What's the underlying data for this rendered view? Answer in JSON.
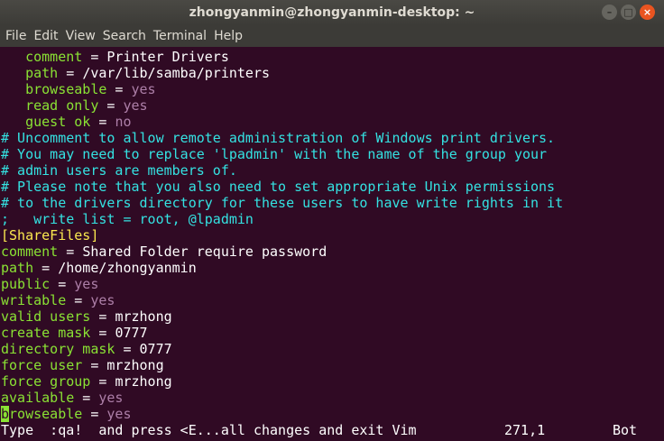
{
  "window": {
    "title": "zhongyanmin@zhongyanmin-desktop: ~",
    "minimize_glyph": "–",
    "maximize_glyph": "□",
    "close_glyph": "×"
  },
  "menu": [
    "File",
    "Edit",
    "View",
    "Search",
    "Terminal",
    "Help"
  ],
  "lines": {
    "l0": {
      "indent": "   ",
      "key": "comment",
      "eq": " = ",
      "val": "Printer Drivers"
    },
    "l1": {
      "indent": "   ",
      "key": "path",
      "eq": " = ",
      "val": "/var/lib/samba/printers"
    },
    "l2": {
      "indent": "   ",
      "key": "browseable",
      "eq": " = ",
      "val": "yes"
    },
    "l3": {
      "indent": "   ",
      "key": "read only",
      "eq": " = ",
      "val": "yes"
    },
    "l4": {
      "indent": "   ",
      "key": "guest ok",
      "eq": " = ",
      "val": "no"
    },
    "c0": "# Uncomment to allow remote administration of Windows print drivers.",
    "c1": "# You may need to replace 'lpadmin' with the name of the group your",
    "c2": "# admin users are members of.",
    "c3": "# Please note that you also need to set appropriate Unix permissions",
    "c4": "# to the drivers directory for these users to have write rights in it",
    "c5": ";   write list = root, @lpadmin",
    "section": "[ShareFiles]",
    "s0": {
      "key": "comment",
      "eq": " = ",
      "val": "Shared Folder require password"
    },
    "s1": {
      "key": "path",
      "eq": " = ",
      "val": "/home/zhongyanmin"
    },
    "s2": {
      "key": "public",
      "eq": " = ",
      "val": "yes"
    },
    "s3": {
      "key": "writable",
      "eq": " = ",
      "val": "yes"
    },
    "s4": {
      "key": "valid users",
      "eq": " = ",
      "val": "mrzhong"
    },
    "s5": {
      "key": "create mask",
      "eq": " = ",
      "val": "0777"
    },
    "s6": {
      "key": "directory mask",
      "eq": " = ",
      "val": "0777"
    },
    "s7": {
      "key": "force user",
      "eq": " = ",
      "val": "mrzhong"
    },
    "s8": {
      "key": "force group",
      "eq": " = ",
      "val": "mrzhong"
    },
    "s9": {
      "key": "available",
      "eq": " = ",
      "val": "yes"
    },
    "s10": {
      "cursor": "b",
      "key_rest": "rowseable",
      "eq": " = ",
      "val": "yes"
    }
  },
  "status": {
    "message": "Type  :qa!  and press <E...all changes and exit Vim",
    "position": "271,1",
    "scroll": "Bot"
  },
  "colors": {
    "background": "#300a24",
    "key": "#8ae234",
    "value": "#ad7fa8",
    "comment": "#34e2e2",
    "section": "#fce94f"
  }
}
